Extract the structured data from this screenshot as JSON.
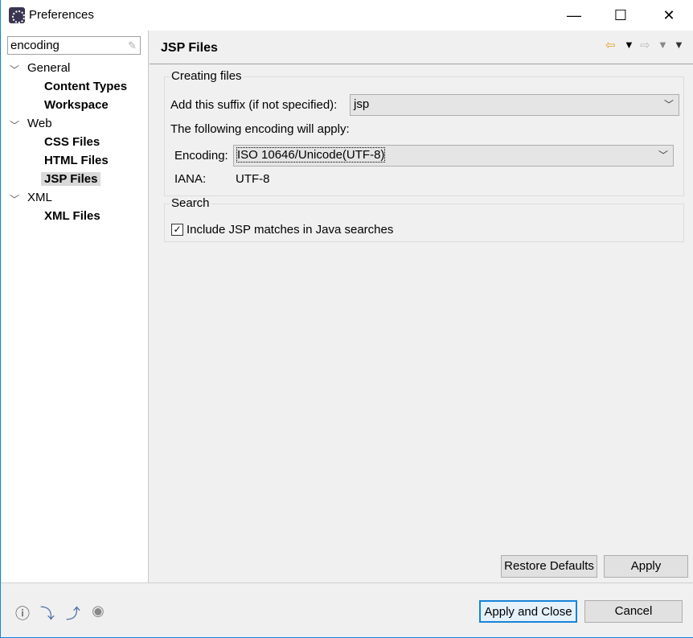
{
  "window": {
    "title": "Preferences",
    "minimize": "—",
    "maximize": "☐",
    "close": "✕"
  },
  "filter": {
    "value": "encoding"
  },
  "tree": [
    {
      "label": "General",
      "type": "category"
    },
    {
      "label": "Content Types",
      "type": "leaf"
    },
    {
      "label": "Workspace",
      "type": "leaf"
    },
    {
      "label": "Web",
      "type": "category"
    },
    {
      "label": "CSS Files",
      "type": "leaf"
    },
    {
      "label": "HTML Files",
      "type": "leaf"
    },
    {
      "label": "JSP Files",
      "type": "leaf",
      "selected": true
    },
    {
      "label": "XML",
      "type": "category"
    },
    {
      "label": "XML Files",
      "type": "leaf"
    }
  ],
  "page": {
    "title": "JSP Files"
  },
  "creating": {
    "group": "Creating files",
    "suffix_label": "Add this suffix (if not specified):",
    "suffix_value": "jsp",
    "apply_text": "The following encoding will apply:",
    "encoding_label": "Encoding:",
    "encoding_value": "ISO 10646/Unicode(UTF-8)",
    "iana_label": "IANA:",
    "iana_value": "UTF-8"
  },
  "search": {
    "group": "Search",
    "checkbox_label": "Include JSP matches in Java searches",
    "checked": true
  },
  "buttons": {
    "restore": "Restore Defaults",
    "apply": "Apply",
    "apply_close": "Apply and Close",
    "cancel": "Cancel"
  },
  "colors": {
    "accent": "#1883d7",
    "nav_back": "#e0a020"
  }
}
